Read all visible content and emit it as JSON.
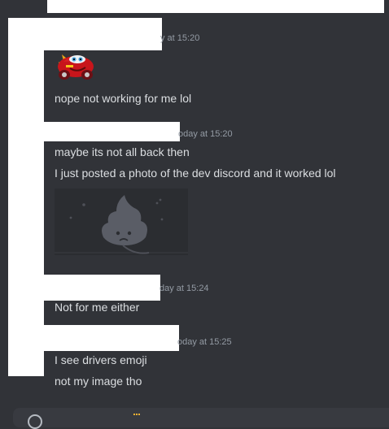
{
  "messages": [
    {
      "timestamp": "y at 15:20",
      "lines": [
        "nope not working for me lol"
      ],
      "emoji": "lightning-mcqueen-emoji"
    },
    {
      "timestamp": "oday at 15:20",
      "lines": [
        "maybe its not all back then",
        "I just posted a photo of the dev discord and it worked lol"
      ],
      "image": "broken-image-placeholder"
    },
    {
      "timestamp": "day at 15:24",
      "lines": [
        "Not for me either"
      ]
    },
    {
      "timestamp": "oday at 15:25",
      "lines": [
        "I see drivers emoji",
        "not my image tho"
      ]
    }
  ],
  "colors": {
    "background": "#313338",
    "text": "#dbdee1",
    "timestamp": "#949ba4",
    "redaction": "#ffffff"
  }
}
